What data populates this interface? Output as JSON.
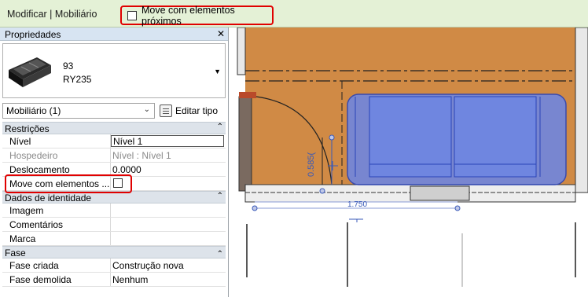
{
  "context_bar": {
    "title": "Modificar | Mobiliário",
    "option_label": "Move com elementos próximos"
  },
  "properties": {
    "header": "Propriedades",
    "close_glyph": "✕",
    "type_line1": "93",
    "type_line2": "RY235",
    "instance_selector": "Mobiliário (1)",
    "edit_type_label": "Editar tipo",
    "groups": {
      "restricoes": "Restrições",
      "dados": "Dados de identidade",
      "fase": "Fase"
    },
    "rows": {
      "nivel": {
        "key": "Nível",
        "value": "Nível 1"
      },
      "hospedeiro": {
        "key": "Hospedeiro",
        "value": "Nível : Nível 1"
      },
      "deslocamento": {
        "key": "Deslocamento",
        "value": "0.0000"
      },
      "move": {
        "key": "Move com elementos ..."
      },
      "imagem": {
        "key": "Imagem"
      },
      "comentarios": {
        "key": "Comentários"
      },
      "marca": {
        "key": "Marca"
      },
      "fase_criada": {
        "key": "Fase criada",
        "value": "Construção nova"
      },
      "fase_demolida": {
        "key": "Fase demolida",
        "value": "Nenhum"
      }
    }
  },
  "drawing": {
    "dim_vertical": "0.585(",
    "dim_horizontal": "1.750"
  },
  "colors": {
    "floor": "#d08a45",
    "sofa_fill": "#6f86e0",
    "sofa_stroke": "#2a44b8",
    "highlight": "#e00000"
  }
}
